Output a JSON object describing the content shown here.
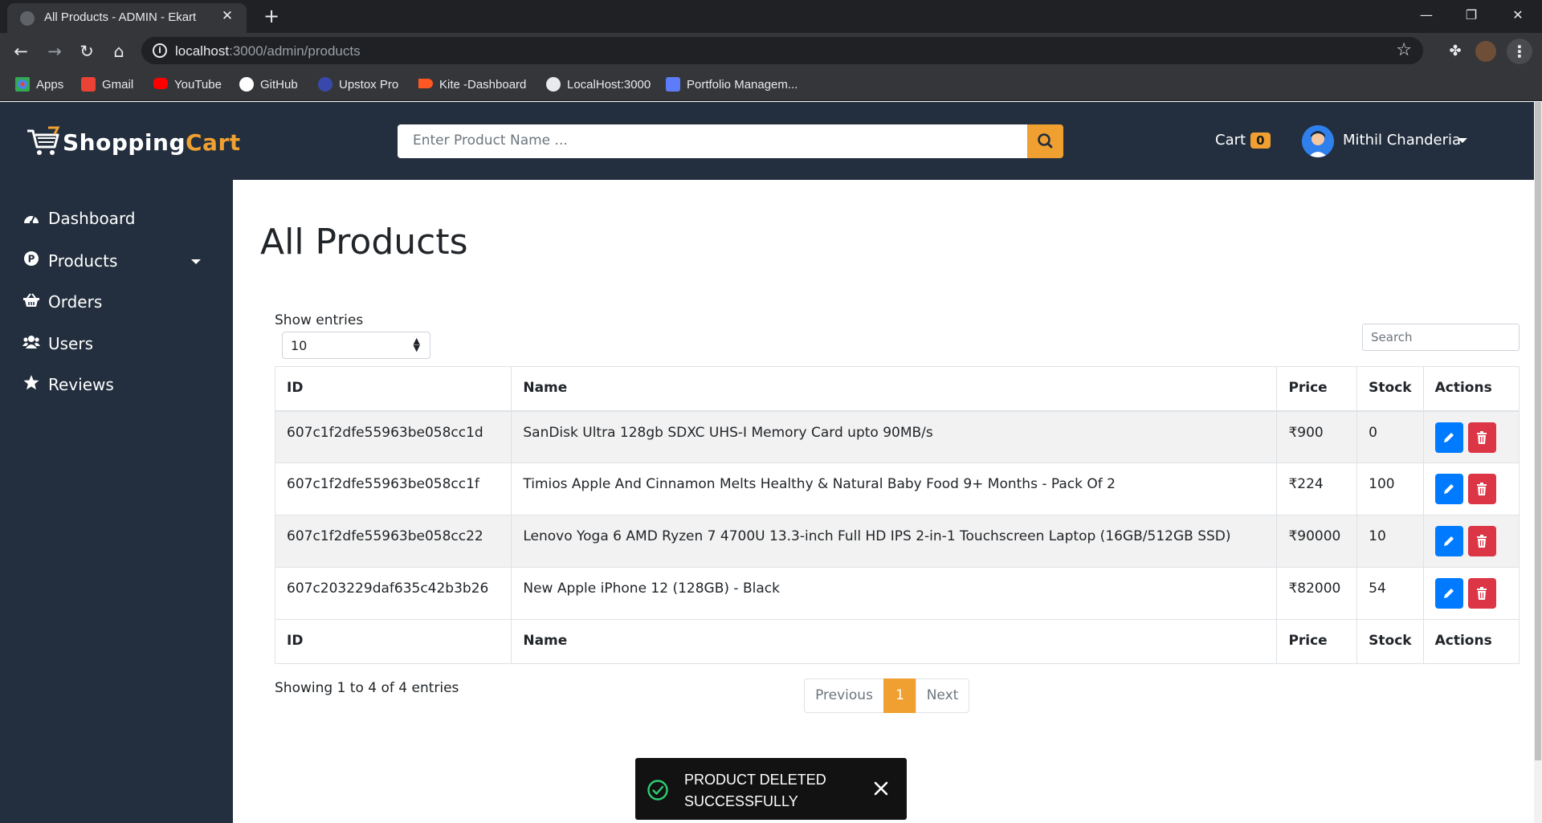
{
  "browser": {
    "tab_title": "All Products - ADMIN - Ekart",
    "tab_close": "✕",
    "new_tab": "+",
    "url_host": "localhost",
    "url_rest": ":3000/admin/products",
    "bookmarks": [
      {
        "label": "Apps",
        "color": "#4285f4"
      },
      {
        "label": "Gmail",
        "color": "#ea4335"
      },
      {
        "label": "YouTube",
        "color": "#ff0000"
      },
      {
        "label": "GitHub",
        "color": "#ffffff"
      },
      {
        "label": "Upstox Pro",
        "color": "#3949ab"
      },
      {
        "label": "Kite -Dashboard",
        "color": "#ff5722"
      },
      {
        "label": "LocalHost:3000",
        "color": "#e8eaed"
      },
      {
        "label": "Portfolio Managem...",
        "color": "#5c7cfa"
      }
    ]
  },
  "header": {
    "logo_part1": "Shopping",
    "logo_part2": "Cart",
    "search_placeholder": "Enter Product Name ...",
    "cart_label": "Cart",
    "cart_count": "0",
    "user_name": "Mithil Chanderia",
    "accent": "#f0a030",
    "bg": "#232f3e"
  },
  "sidebar": {
    "items": [
      {
        "label": "Dashboard",
        "icon": "tachometer-icon"
      },
      {
        "label": "Products",
        "icon": "product-icon"
      },
      {
        "label": "Orders",
        "icon": "basket-icon"
      },
      {
        "label": "Users",
        "icon": "users-icon"
      },
      {
        "label": "Reviews",
        "icon": "star-icon"
      }
    ]
  },
  "main": {
    "title": "All Products",
    "show_entries_label": "Show entries",
    "entries_value": "10",
    "search_placeholder": "Search",
    "columns": [
      "ID",
      "Name",
      "Price",
      "Stock",
      "Actions"
    ],
    "rows": [
      {
        "id": "607c1f2dfe55963be058cc1d",
        "name": "SanDisk Ultra 128gb SDXC UHS-I Memory Card upto 90MB/s",
        "price": "₹900",
        "stock": "0"
      },
      {
        "id": "607c1f2dfe55963be058cc1f",
        "name": "Timios Apple And Cinnamon Melts Healthy & Natural Baby Food 9+ Months - Pack Of 2",
        "price": "₹224",
        "stock": "100"
      },
      {
        "id": "607c1f2dfe55963be058cc22",
        "name": "Lenovo Yoga 6 AMD Ryzen 7 4700U 13.3-inch Full HD IPS 2-in-1 Touchscreen Laptop (16GB/512GB SSD)",
        "price": "₹90000",
        "stock": "10"
      },
      {
        "id": "607c203229daf635c42b3b26",
        "name": "New Apple iPhone 12 (128GB) - Black",
        "price": "₹82000",
        "stock": "54"
      }
    ],
    "info": "Showing 1 to 4 of 4 entries",
    "pager": {
      "previous": "Previous",
      "current": "1",
      "next": "Next"
    }
  },
  "toast": {
    "message": "PRODUCT DELETED SUCCESSFULLY"
  }
}
